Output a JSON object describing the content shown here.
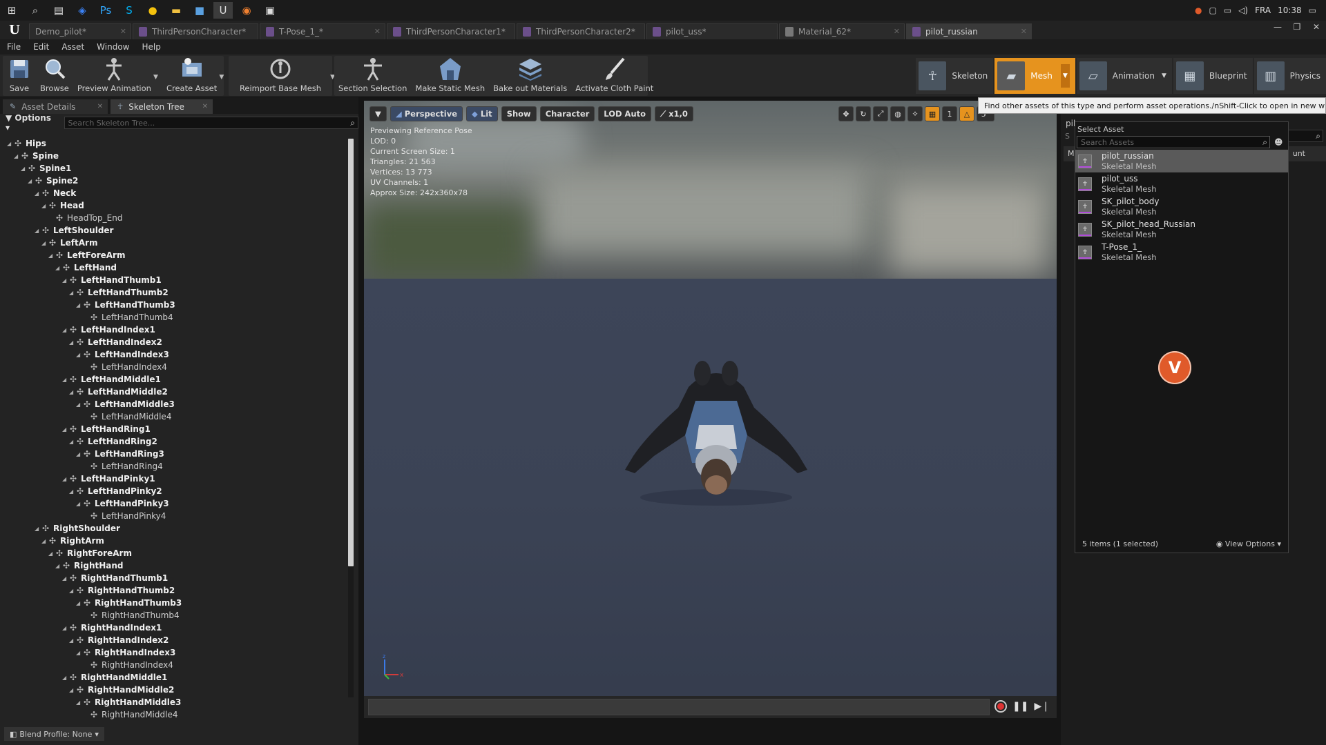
{
  "taskbar": {
    "icons": [
      "windows-start",
      "search",
      "task-view",
      "app-dropbox",
      "app-photoshop",
      "app-skype",
      "app-chrome",
      "app-explorer",
      "app-3",
      "app-unreal",
      "app-blender",
      "app-other"
    ],
    "language": "FRA",
    "time": "10:38"
  },
  "tabs": [
    {
      "label": "Demo_pilot*"
    },
    {
      "label": "ThirdPersonCharacter*"
    },
    {
      "label": "T-Pose_1_*"
    },
    {
      "label": "ThirdPersonCharacter1*"
    },
    {
      "label": "ThirdPersonCharacter2*"
    },
    {
      "label": "pilot_uss*"
    },
    {
      "label": "Material_62*"
    },
    {
      "label": "pilot_russian"
    }
  ],
  "menu": [
    "File",
    "Edit",
    "Asset",
    "Window",
    "Help"
  ],
  "toolbar": {
    "tools": [
      {
        "label": "Save",
        "icon": "save-icon"
      },
      {
        "label": "Browse",
        "icon": "browse-icon"
      },
      {
        "label": "Preview Animation",
        "icon": "preview-animation-icon"
      },
      {
        "label": "Create Asset",
        "icon": "create-asset-icon"
      },
      {
        "label": "Reimport Base Mesh",
        "icon": "reimport-icon"
      },
      {
        "label": "Section Selection",
        "icon": "section-selection-icon"
      },
      {
        "label": "Make Static Mesh",
        "icon": "static-mesh-icon"
      },
      {
        "label": "Bake out Materials",
        "icon": "bake-materials-icon"
      },
      {
        "label": "Activate Cloth Paint",
        "icon": "cloth-paint-icon"
      }
    ],
    "modes": [
      {
        "label": "Skeleton"
      },
      {
        "label": "Mesh"
      },
      {
        "label": "Animation"
      },
      {
        "label": "Blueprint"
      },
      {
        "label": "Physics"
      }
    ]
  },
  "tooltip": "Find other assets of this type and perform asset operations./nShift-Click to open in new window.",
  "left_panel": {
    "tabs": [
      {
        "label": "Asset Details"
      },
      {
        "label": "Skeleton Tree"
      }
    ],
    "options_label": "Options",
    "search_placeholder": "Search Skeleton Tree...",
    "bones": [
      {
        "name": "Hips",
        "depth": 0,
        "branch": true
      },
      {
        "name": "Spine",
        "depth": 1,
        "branch": true
      },
      {
        "name": "Spine1",
        "depth": 2,
        "branch": true
      },
      {
        "name": "Spine2",
        "depth": 3,
        "branch": true
      },
      {
        "name": "Neck",
        "depth": 4,
        "branch": true
      },
      {
        "name": "Head",
        "depth": 5,
        "branch": true
      },
      {
        "name": "HeadTop_End",
        "depth": 6,
        "branch": false
      },
      {
        "name": "LeftShoulder",
        "depth": 4,
        "branch": true
      },
      {
        "name": "LeftArm",
        "depth": 5,
        "branch": true
      },
      {
        "name": "LeftForeArm",
        "depth": 6,
        "branch": true
      },
      {
        "name": "LeftHand",
        "depth": 7,
        "branch": true
      },
      {
        "name": "LeftHandThumb1",
        "depth": 8,
        "branch": true
      },
      {
        "name": "LeftHandThumb2",
        "depth": 9,
        "branch": true
      },
      {
        "name": "LeftHandThumb3",
        "depth": 10,
        "branch": true
      },
      {
        "name": "LeftHandThumb4",
        "depth": 11,
        "branch": false
      },
      {
        "name": "LeftHandIndex1",
        "depth": 8,
        "branch": true
      },
      {
        "name": "LeftHandIndex2",
        "depth": 9,
        "branch": true
      },
      {
        "name": "LeftHandIndex3",
        "depth": 10,
        "branch": true
      },
      {
        "name": "LeftHandIndex4",
        "depth": 11,
        "branch": false
      },
      {
        "name": "LeftHandMiddle1",
        "depth": 8,
        "branch": true
      },
      {
        "name": "LeftHandMiddle2",
        "depth": 9,
        "branch": true
      },
      {
        "name": "LeftHandMiddle3",
        "depth": 10,
        "branch": true
      },
      {
        "name": "LeftHandMiddle4",
        "depth": 11,
        "branch": false
      },
      {
        "name": "LeftHandRing1",
        "depth": 8,
        "branch": true
      },
      {
        "name": "LeftHandRing2",
        "depth": 9,
        "branch": true
      },
      {
        "name": "LeftHandRing3",
        "depth": 10,
        "branch": true
      },
      {
        "name": "LeftHandRing4",
        "depth": 11,
        "branch": false
      },
      {
        "name": "LeftHandPinky1",
        "depth": 8,
        "branch": true
      },
      {
        "name": "LeftHandPinky2",
        "depth": 9,
        "branch": true
      },
      {
        "name": "LeftHandPinky3",
        "depth": 10,
        "branch": true
      },
      {
        "name": "LeftHandPinky4",
        "depth": 11,
        "branch": false
      },
      {
        "name": "RightShoulder",
        "depth": 4,
        "branch": true
      },
      {
        "name": "RightArm",
        "depth": 5,
        "branch": true
      },
      {
        "name": "RightForeArm",
        "depth": 6,
        "branch": true
      },
      {
        "name": "RightHand",
        "depth": 7,
        "branch": true
      },
      {
        "name": "RightHandThumb1",
        "depth": 8,
        "branch": true
      },
      {
        "name": "RightHandThumb2",
        "depth": 9,
        "branch": true
      },
      {
        "name": "RightHandThumb3",
        "depth": 10,
        "branch": true
      },
      {
        "name": "RightHandThumb4",
        "depth": 11,
        "branch": false
      },
      {
        "name": "RightHandIndex1",
        "depth": 8,
        "branch": true
      },
      {
        "name": "RightHandIndex2",
        "depth": 9,
        "branch": true
      },
      {
        "name": "RightHandIndex3",
        "depth": 10,
        "branch": true
      },
      {
        "name": "RightHandIndex4",
        "depth": 11,
        "branch": false
      },
      {
        "name": "RightHandMiddle1",
        "depth": 8,
        "branch": true
      },
      {
        "name": "RightHandMiddle2",
        "depth": 9,
        "branch": true
      },
      {
        "name": "RightHandMiddle3",
        "depth": 10,
        "branch": true
      },
      {
        "name": "RightHandMiddle4",
        "depth": 11,
        "branch": false
      }
    ],
    "blend_profile": "Blend Profile: None"
  },
  "viewport": {
    "buttons": [
      "Perspective",
      "Lit",
      "Show",
      "Character",
      "LOD Auto",
      "x1,0"
    ],
    "right_tools": [
      "1",
      "5°"
    ],
    "info_lines": [
      "Previewing Reference Pose",
      "LOD: 0",
      "Current Screen Size: 1",
      "Triangles: 21 563",
      "Vertices: 13 773",
      "UV Channels: 1",
      "Approx Size: 242x360x78"
    ],
    "axis_labels": {
      "x": "x",
      "z": "z"
    }
  },
  "right_panel": {
    "frag_title": "pil",
    "frag_s": "S",
    "frag_m": "M",
    "frag_count": "unt"
  },
  "asset_picker": {
    "title": "Select Asset",
    "search_placeholder": "Search Assets",
    "items": [
      {
        "name": "pilot_russian",
        "type": "Skeletal Mesh",
        "selected": true
      },
      {
        "name": "pilot_uss",
        "type": "Skeletal Mesh",
        "selected": false
      },
      {
        "name": "SK_pilot_body",
        "type": "Skeletal Mesh",
        "selected": false
      },
      {
        "name": "SK_pilot_head_Russian",
        "type": "Skeletal Mesh",
        "selected": false
      },
      {
        "name": "T-Pose_1_",
        "type": "Skeletal Mesh",
        "selected": false
      }
    ],
    "footer_count": "5 items (1 selected)",
    "view_options": "View Options"
  }
}
